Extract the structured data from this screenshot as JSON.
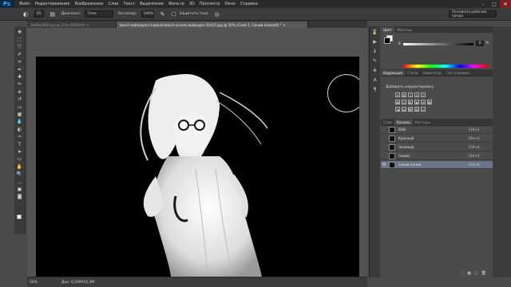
{
  "app": {
    "logo": "Ps"
  },
  "menubar": {
    "items": [
      "Файл",
      "Редактирование",
      "Изображение",
      "Слои",
      "Текст",
      "Выделение",
      "Фильтр",
      "3D",
      "Просмотр",
      "Окно",
      "Справка"
    ]
  },
  "window_controls": {
    "minimize": "–",
    "maximize": "□",
    "close": "✕"
  },
  "options": {
    "brush_size": "65",
    "range_label": "Диапазон:",
    "range_value": "Тени",
    "exposure_label": "Экспонир:",
    "exposure_value": "100%",
    "protect_tones_label": "Защитить тона",
    "workspace": "Основная рабочая среда"
  },
  "tabs": [
    {
      "label": "3840x2400.jpg @ 25% (RGB/8#) ×"
    },
    {
      "label": "beach-wallpapers-tropical-beach-scenes-wallpaper-35415.jpg @ 50% (Слой 1, Синий копия/8) * ×"
    }
  ],
  "status": {
    "zoom": "50%",
    "doc": "Док: 6,59М/16,3М"
  },
  "color_panel": {
    "tabs": [
      "Цвет",
      "Образцы"
    ],
    "slider_label": "K",
    "value": "0",
    "unit": "%"
  },
  "adjust_panel": {
    "tabs": [
      "Коррекция",
      "Стили",
      "Навигатор",
      "Гистограмма"
    ],
    "title": "Добавить корректировку"
  },
  "channels_panel": {
    "tabs": [
      "Слои",
      "Каналы",
      "Контуры"
    ],
    "rows": [
      {
        "name": "RGB",
        "key": "Ctrl+2"
      },
      {
        "name": "Красный",
        "key": "Ctrl+3"
      },
      {
        "name": "Зеленый",
        "key": "Ctrl+4"
      },
      {
        "name": "Синий",
        "key": "Ctrl+5"
      },
      {
        "name": "Синий копия",
        "key": "Ctrl+6"
      }
    ]
  }
}
